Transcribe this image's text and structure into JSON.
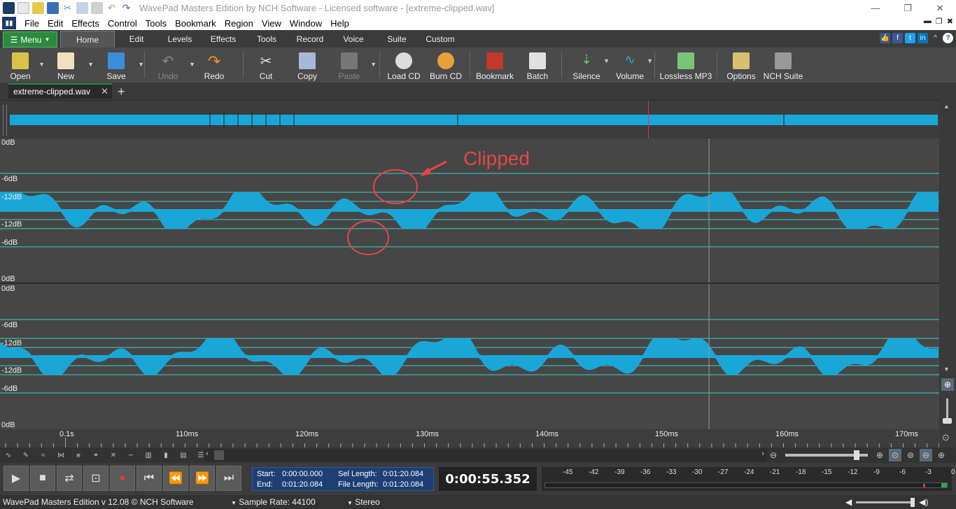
{
  "window": {
    "title": "WavePad Masters Edition by NCH Software - Licensed software - [extreme-clipped.wav]"
  },
  "menu": [
    "File",
    "Edit",
    "Effects",
    "Control",
    "Tools",
    "Bookmark",
    "Region",
    "View",
    "Window",
    "Help"
  ],
  "ribbon": {
    "menu_button": "Menu",
    "tabs": [
      "Home",
      "Edit",
      "Levels",
      "Effects",
      "Tools",
      "Record",
      "Voice",
      "Suite",
      "Custom"
    ],
    "active_tab": "Home"
  },
  "toolbar": {
    "open": "Open",
    "new": "New",
    "save": "Save",
    "undo": "Undo",
    "redo": "Redo",
    "cut": "Cut",
    "copy": "Copy",
    "paste": "Paste",
    "load_cd": "Load CD",
    "burn_cd": "Burn CD",
    "bookmark": "Bookmark",
    "batch": "Batch",
    "silence": "Silence",
    "volume": "Volume",
    "lossless_mp3": "Lossless MP3",
    "options": "Options",
    "nch_suite": "NCH Suite"
  },
  "file_tab": {
    "name": "extreme-clipped.wav"
  },
  "db_labels": [
    "0dB",
    "-6dB",
    "-12dB",
    "-12dB",
    "-6dB",
    "0dB",
    "0dB",
    "-6dB",
    "-12dB",
    "-12dB",
    "-6dB",
    "0dB"
  ],
  "timeline": [
    "0.1s",
    "110ms",
    "120ms",
    "130ms",
    "140ms",
    "150ms",
    "160ms",
    "170ms"
  ],
  "annotation": {
    "text": "Clipped",
    "color": "#e64545"
  },
  "selection": {
    "start_label": "Start:",
    "start": "0:00:00.000",
    "end_label": "End:",
    "end": "0:01:20.084",
    "sel_length_label": "Sel Length:",
    "sel_length": "0:01:20.084",
    "file_length_label": "File Length:",
    "file_length": "0:01:20.084"
  },
  "clock": "0:00:55.352",
  "meter_labels": [
    "-45",
    "-42",
    "-39",
    "-36",
    "-33",
    "-30",
    "-27",
    "-24",
    "-21",
    "-18",
    "-15",
    "-12",
    "-9",
    "-6",
    "-3",
    "0"
  ],
  "status": {
    "version": "WavePad Masters Edition v 12.08 © NCH Software",
    "sample_rate": "Sample Rate: 44100",
    "channels": "Stereo"
  },
  "colors": {
    "wave": "#1aa7d8",
    "accent": "#2b8a3e",
    "clip_line": "#3ad0d0"
  }
}
